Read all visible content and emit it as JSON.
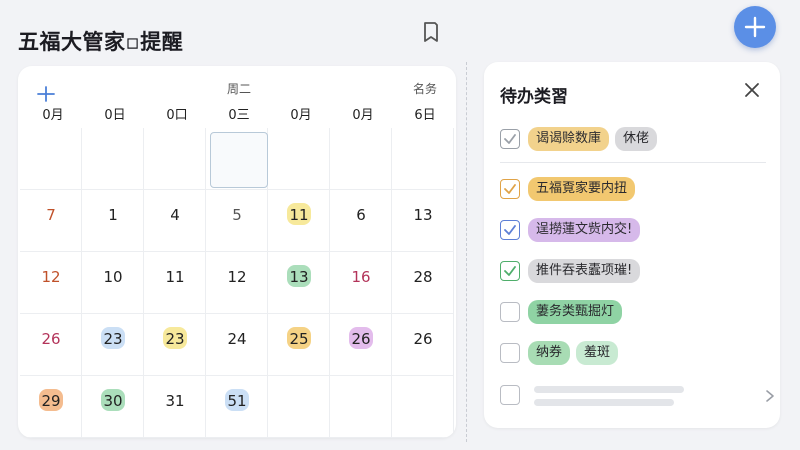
{
  "app": {
    "title": "五福大管家▫提醒"
  },
  "calendar": {
    "header": [
      {
        "top": "",
        "bot": "0月"
      },
      {
        "top": "",
        "bot": "0日"
      },
      {
        "top": "",
        "bot": "0口"
      },
      {
        "top": "周二",
        "bot": "0三"
      },
      {
        "top": "",
        "bot": "0月"
      },
      {
        "top": "",
        "bot": "0月"
      },
      {
        "top": "名务",
        "bot": "6日"
      }
    ],
    "rows": [
      [
        {
          "n": ""
        },
        {
          "n": ""
        },
        {
          "n": ""
        },
        {
          "n": "",
          "selected": true
        },
        {
          "n": ""
        },
        {
          "n": ""
        },
        {
          "n": ""
        }
      ],
      [
        {
          "n": "7",
          "color": "#c0512a"
        },
        {
          "n": "1"
        },
        {
          "n": "4"
        },
        {
          "n": "5",
          "color": "#555"
        },
        {
          "n": "11",
          "hl": "#f4e27a"
        },
        {
          "n": "6"
        },
        {
          "n": "13"
        }
      ],
      [
        {
          "n": "12",
          "color": "#c0512a"
        },
        {
          "n": "10"
        },
        {
          "n": "11"
        },
        {
          "n": "12"
        },
        {
          "n": "13",
          "hl": "#8fd3a4"
        },
        {
          "n": "16",
          "color": "#b3345a"
        },
        {
          "n": "28"
        }
      ],
      [
        {
          "n": "26",
          "color": "#b3345a"
        },
        {
          "n": "23",
          "hl": "#b9d4f2"
        },
        {
          "n": "23",
          "hl": "#f4e27a"
        },
        {
          "n": "24"
        },
        {
          "n": "25",
          "hl": "#f2c35c"
        },
        {
          "n": "26",
          "hl": "#d9a6e6"
        },
        {
          "n": "26"
        }
      ],
      [
        {
          "n": "29",
          "hl": "#f0a56a"
        },
        {
          "n": "30",
          "hl": "#8fd3a4"
        },
        {
          "n": "31"
        },
        {
          "n": "51",
          "hl": "#b9d4f2"
        },
        {
          "n": ""
        },
        {
          "n": ""
        },
        {
          "n": ""
        }
      ]
    ]
  },
  "todo": {
    "title": "待办类習",
    "items": [
      {
        "checked": true,
        "check_color": "#9aa0a8",
        "tags": [
          {
            "text": "谒谒赊数庫",
            "bg": "#f2d28c"
          },
          {
            "text": "休佬",
            "bg": "#d9d9dc"
          }
        ]
      },
      {
        "checked": true,
        "check_color": "#e0a347",
        "tags": [
          {
            "text": "五福覔家要内扭",
            "bg": "#f2c870"
          }
        ]
      },
      {
        "checked": true,
        "check_color": "#5d7fd6",
        "tags": [
          {
            "text": "逞撈蓮文赀内交!",
            "bg": "#d6b9ea"
          }
        ]
      },
      {
        "checked": true,
        "check_color": "#4fae6b",
        "tags": [
          {
            "text": "推件吞表蠹项璀!",
            "bg": "#d9d9dc"
          }
        ]
      },
      {
        "checked": false,
        "tags": [
          {
            "text": "萋务类甄掘灯",
            "bg": "#8fd3a4"
          }
        ]
      },
      {
        "checked": false,
        "tags": [
          {
            "text": "纳券",
            "bg": "#a8dcb4"
          },
          {
            "text": "羞斑",
            "bg": "#c8ead2"
          }
        ]
      }
    ]
  },
  "icons": {
    "add": "plus-icon",
    "bookmark": "bookmark-icon",
    "close": "close-icon",
    "chevron": "chevron-right-icon",
    "calendar_add": "plus-small-icon"
  }
}
